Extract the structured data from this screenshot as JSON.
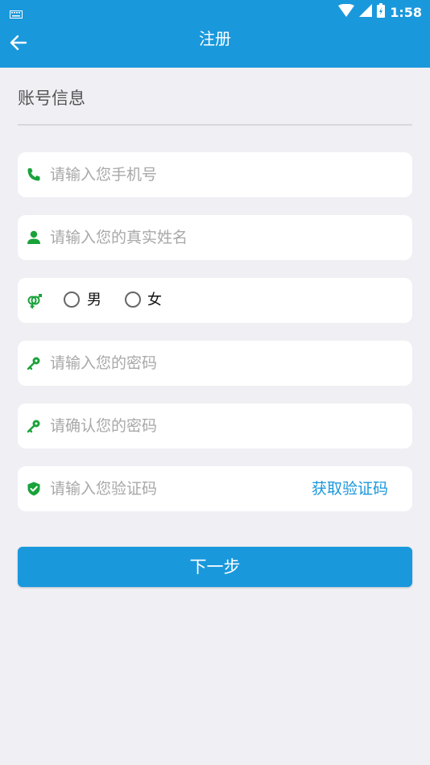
{
  "status_bar": {
    "time": "1:58"
  },
  "app_bar": {
    "title": "注册"
  },
  "section": {
    "title": "账号信息"
  },
  "form": {
    "phone_placeholder": "请输入您手机号",
    "name_placeholder": "请输入您的真实姓名",
    "gender": {
      "male": "男",
      "female": "女"
    },
    "password_placeholder": "请输入您的密码",
    "confirm_password_placeholder": "请确认您的密码",
    "code_placeholder": "请输入您验证码",
    "get_code_label": "获取验证码"
  },
  "next_button": {
    "label": "下一步"
  },
  "colors": {
    "primary": "#1a98dc",
    "icon_green": "#1aa23a",
    "background": "#efeff4"
  }
}
